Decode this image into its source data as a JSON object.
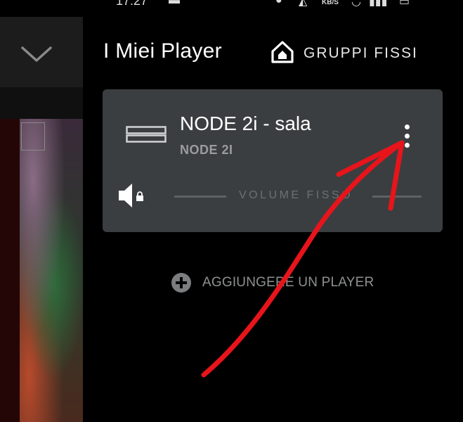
{
  "status_bar": {
    "time": "17:27",
    "network_speed": "KB/S"
  },
  "header": {
    "title": "I Miei Player",
    "groups_button_label": "GRUPPI FISSI"
  },
  "player_card": {
    "name": "NODE 2i - sala",
    "model": "NODE 2I",
    "volume_label": "VOLUME FISSO"
  },
  "add_player_label": "AGGIUNGERE UN PLAYER",
  "icons": {
    "collapse": "chevron-down-icon",
    "groups": "home-icon",
    "device": "stacked-device-icon",
    "more": "more-vertical-icon",
    "speaker": "speaker-icon",
    "lock": "lock-icon",
    "add": "plus-circle-icon"
  },
  "colors": {
    "card_background": "#3b3e40",
    "annotation_arrow": "#e8141b"
  }
}
